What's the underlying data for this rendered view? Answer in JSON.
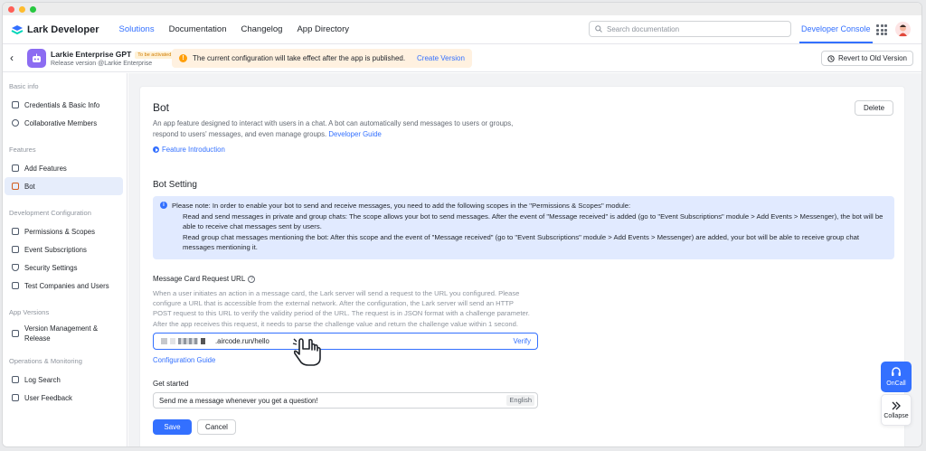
{
  "colors": {
    "accent": "#3370ff",
    "warning": "#ff9f0a",
    "app_icon": "#8c6cf2",
    "info_bg": "#e1eaff"
  },
  "nav": {
    "brand": "Lark Developer",
    "links": [
      "Solutions",
      "Documentation",
      "Changelog",
      "App Directory"
    ],
    "search_placeholder": "Search documentation",
    "console": "Developer Console"
  },
  "app": {
    "name": "Larkie Enterprise GPT",
    "tag": "To be activated",
    "subtitle": "Release version @Larkie Enterprise",
    "notice": "The current configuration will take effect after the app is published.",
    "notice_link": "Create Version",
    "revert": "Revert to Old Version"
  },
  "sidebar": {
    "sections": [
      {
        "title": "Basic info",
        "items": [
          "Credentials & Basic Info",
          "Collaborative Members"
        ]
      },
      {
        "title": "Features",
        "items": [
          "Add Features",
          "Bot"
        ]
      },
      {
        "title": "Development Configuration",
        "items": [
          "Permissions & Scopes",
          "Event Subscriptions",
          "Security Settings",
          "Test Companies and Users"
        ]
      },
      {
        "title": "App Versions",
        "items": [
          "Version Management & Release"
        ]
      },
      {
        "title": "Operations & Monitoring",
        "items": [
          "Log Search",
          "User Feedback"
        ]
      }
    ]
  },
  "bot": {
    "title": "Bot",
    "delete": "Delete",
    "description": "An app feature designed to interact with users in a chat. A bot can automatically send messages to users or groups, respond to users' messages, and even manage groups.",
    "dev_guide": "Developer Guide",
    "feature_intro": "Feature Introduction",
    "setting_title": "Bot Setting",
    "note_title": "Please note: In order to enable your bot to send and receive messages, you need to add the following scopes in the \"Permissions & Scopes\" module:",
    "note_1": "Read and send messages in private and group chats: The scope allows your bot to send messages. After the event of \"Message received\" is added (go to \"Event Subscriptions\" module > Add Events > Messenger), the bot will be able to receive chat messages sent by users.",
    "note_2": "Read group chat messages mentioning the bot: After this scope and the event of \"Message received\" (go to \"Event Subscriptions\" module > Add Events > Messenger) are added, your bot will be able to receive group chat messages mentioning it.",
    "url_label": "Message Card Request URL",
    "url_desc": "When a user initiates an action in a message card, the Lark server will send a request to the URL you configured. Please configure a URL that is accessible from the external network. After the configuration, the Lark server will send an HTTP POST request to this URL to verify the validity period of the URL. The request is in JSON format with a challenge parameter. After the app receives this request, it needs to parse the challenge value and return the challenge value within 1 second.",
    "url_value": ".aircode.run/hello",
    "verify": "Verify",
    "config_guide": "Configuration Guide",
    "get_started": "Get started",
    "get_started_value": "Send me a message whenever you get a question!",
    "language": "English",
    "save": "Save",
    "cancel": "Cancel"
  },
  "floating": {
    "oncall": "OnCall",
    "collapse": "Collapse"
  }
}
